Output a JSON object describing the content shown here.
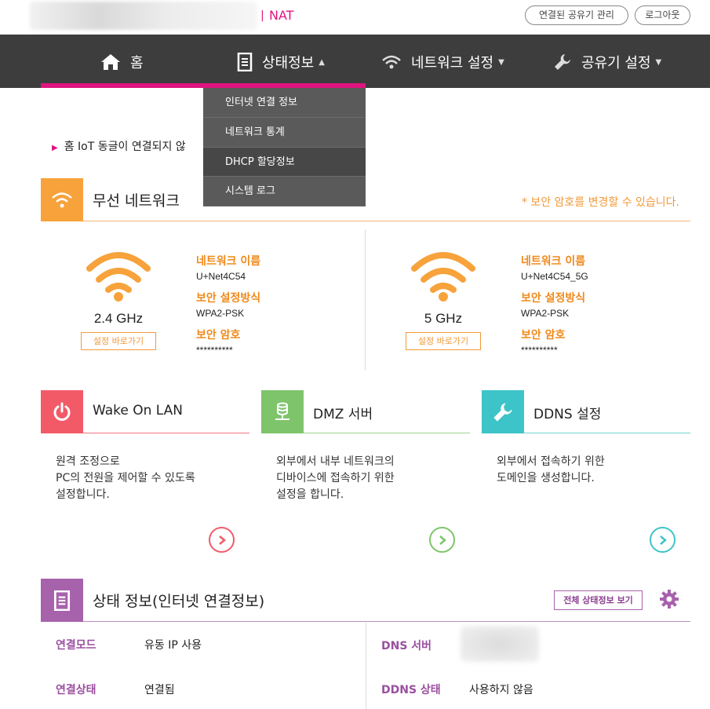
{
  "header": {
    "separator": "|",
    "mode_label": "NAT",
    "manage_button": "연결된 공유기 관리",
    "logout_button": "로그아웃"
  },
  "nav": {
    "home": "홈",
    "status": "상태정보",
    "network": "네트워크 설정",
    "router": "공유기 설정"
  },
  "dropdown": {
    "items": [
      "인터넷 연결 정보",
      "네트워크 통계",
      "DHCP 할당정보",
      "시스템 로그"
    ]
  },
  "notice": "홈 IoT 동글이 연결되지 않",
  "wireless": {
    "title": "무선 네트워크",
    "note": "* 보안 암호를 변경할 수 있습니다.",
    "bands": [
      {
        "band": "2.4 GHz",
        "goto": "설정 바로가기",
        "name_label": "네트워크 이름",
        "name": "U+Net4C54",
        "security_label": "보안 설정방식",
        "security": "WPA2-PSK",
        "password_label": "보안 암호",
        "password": "**********"
      },
      {
        "band": "5 GHz",
        "goto": "설정 바로가기",
        "name_label": "네트워크 이름",
        "name": "U+Net4C54_5G",
        "security_label": "보안 설정방식",
        "security": "WPA2-PSK",
        "password_label": "보안 암호",
        "password": "**********"
      }
    ]
  },
  "cards": [
    {
      "title": "Wake On LAN",
      "desc": [
        "원격 조정으로",
        "PC의 전원을 제어할 수 있도록",
        "설정합니다."
      ]
    },
    {
      "title": "DMZ 서버",
      "desc": [
        "외부에서 내부 네트워크의",
        "디바이스에 접속하기 위한",
        "설정을 합니다."
      ]
    },
    {
      "title": "DDNS 설정",
      "desc": [
        "외부에서 접속하기 위한",
        "도메인을 생성합니다."
      ]
    }
  ],
  "status": {
    "title": "상태 정보(인터넷 연결정보)",
    "full_button": "전체 상태정보 보기",
    "rows": [
      {
        "label": "연결모드",
        "value": "유동 IP 사용"
      },
      {
        "label": "연결상태",
        "value": "연결됨"
      },
      {
        "label": "DNS 서버",
        "value": ""
      },
      {
        "label": "DDNS 상태",
        "value": "사용하지 않음"
      }
    ]
  },
  "colors": {
    "accent": "#e0137f",
    "nav_bg": "#3d3d3d",
    "wifi": "#f7a23b",
    "wol": "#f25a68",
    "dmz": "#7ec46b",
    "ddns": "#3cc4c8",
    "status": "#a762ac"
  }
}
